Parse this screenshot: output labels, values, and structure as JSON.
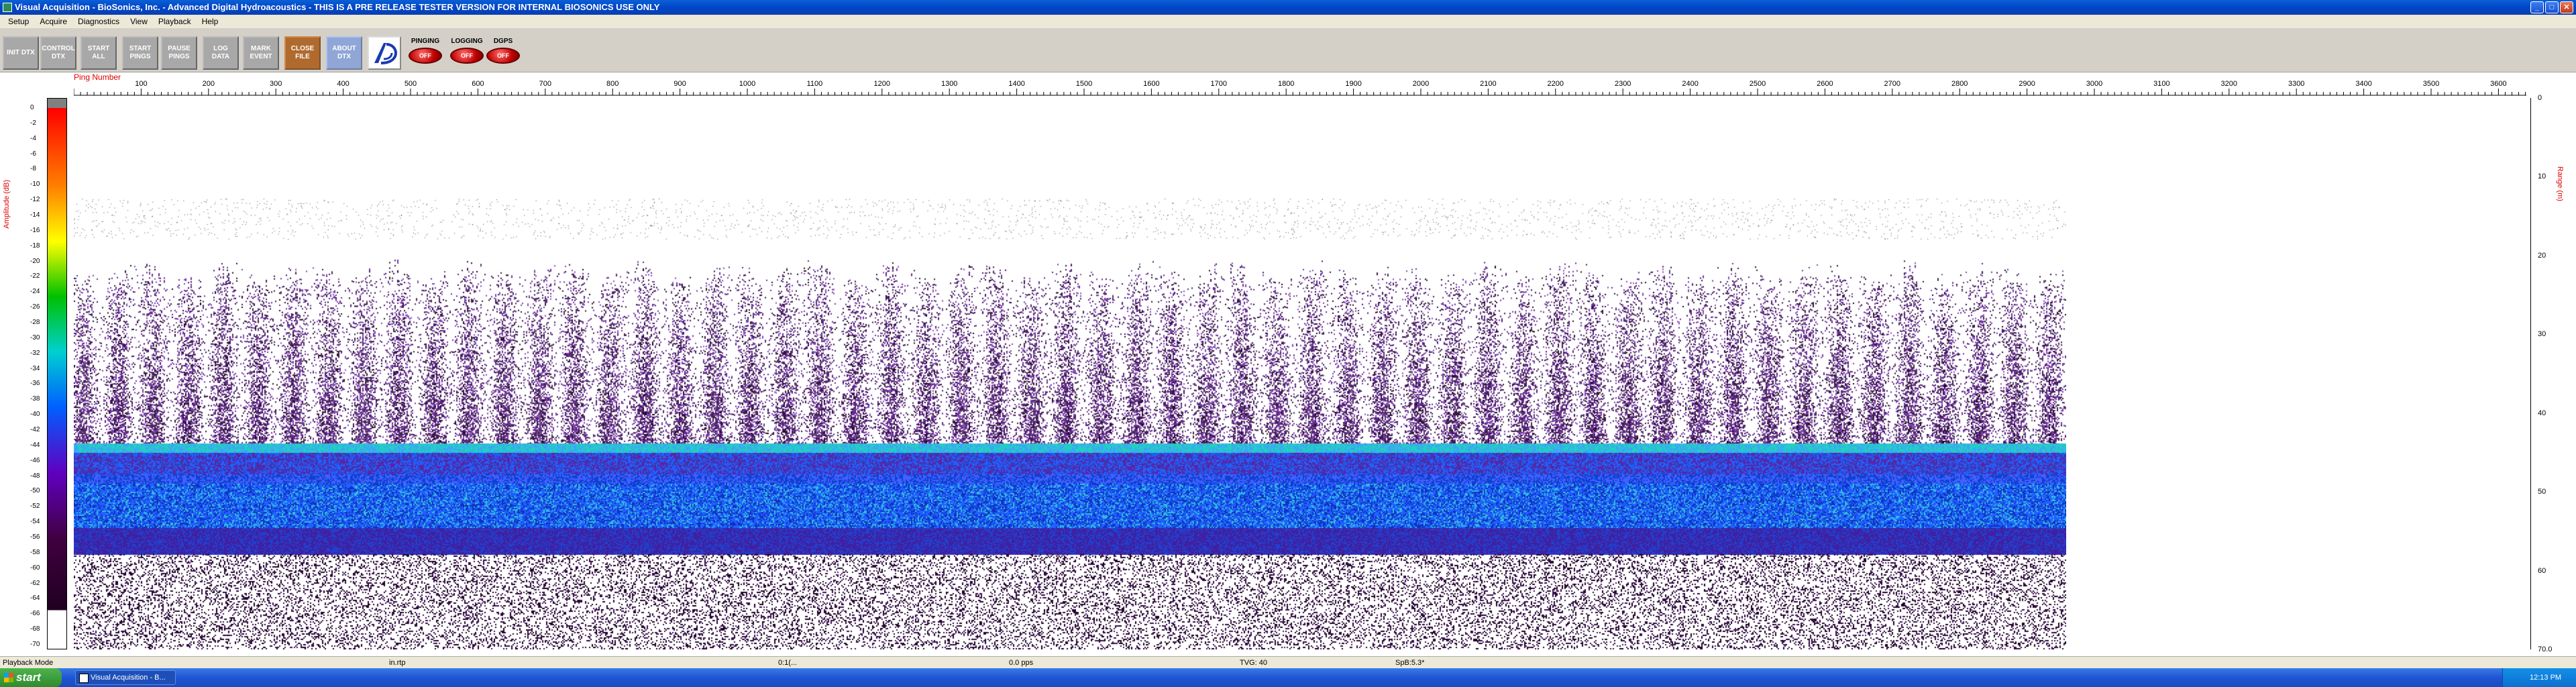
{
  "window": {
    "title": "Visual Acquisition  -  BioSonics, Inc.  -  Advanced Digital Hydroacoustics  -  THIS IS A PRE RELEASE TESTER VERSION FOR INTERNAL BIOSONICS USE ONLY"
  },
  "menu": [
    "Setup",
    "Acquire",
    "Diagnostics",
    "View",
    "Playback",
    "Help"
  ],
  "toolbar": {
    "buttons": [
      {
        "label": "INIT DTX",
        "color": "grey"
      },
      {
        "label": "CONTROL DTX",
        "color": "grey"
      },
      {
        "label": "START ALL",
        "color": "grey"
      },
      {
        "label": "START PINGS",
        "color": "grey"
      },
      {
        "label": "PAUSE PINGS",
        "color": "grey"
      },
      {
        "label": "LOG DATA",
        "color": "grey"
      },
      {
        "label": "MARK EVENT",
        "color": "grey"
      },
      {
        "label": "CLOSE FILE",
        "color": "brown"
      },
      {
        "label": "ABOUT DTX",
        "color": "blue"
      }
    ],
    "indicators": [
      {
        "label": "PINGING",
        "state": "OFF"
      },
      {
        "label": "LOGGING",
        "state": "OFF"
      },
      {
        "label": "DGPS",
        "state": "OFF"
      }
    ]
  },
  "plot": {
    "x_axis_label": "Ping Number",
    "x_ticks": [
      "100",
      "200",
      "300",
      "400",
      "500",
      "600",
      "700",
      "800",
      "900",
      "1000",
      "1100",
      "1200",
      "1300",
      "1400",
      "1500",
      "1600",
      "1700",
      "1800",
      "1900",
      "2000",
      "2100",
      "2200",
      "2300",
      "2400",
      "2500",
      "2600",
      "2700",
      "2800",
      "2900",
      "3000",
      "3100",
      "3200",
      "3300",
      "3400",
      "3500",
      "3600"
    ],
    "left_axis_label": "Amplitude (dB)",
    "colorbar_ticks": [
      "0",
      "-2",
      "-4",
      "-6",
      "-8",
      "-10",
      "-12",
      "-14",
      "-16",
      "-18",
      "-20",
      "-22",
      "-24",
      "-26",
      "-28",
      "-30",
      "-32",
      "-34",
      "-36",
      "-38",
      "-40",
      "-42",
      "-44",
      "-46",
      "-48",
      "-50",
      "-52",
      "-54",
      "-56",
      "-58",
      "-60",
      "-62",
      "-64",
      "-66",
      "-68",
      "-70"
    ],
    "right_axis_label": "Range (m)",
    "range_ticks": [
      "0",
      "10",
      "20",
      "30",
      "40",
      "50",
      "60",
      "70.0"
    ]
  },
  "statusbar": {
    "mode": "Playback Mode",
    "file": "in.rtp",
    "time": "0:1(...",
    "pings": "0.0 pps",
    "tvg": "TVG: 40",
    "spb": "SpB:5.3*"
  },
  "taskbar": {
    "start": "start",
    "task": "Visual Acquisition - B...",
    "clock": "12:13 PM"
  }
}
